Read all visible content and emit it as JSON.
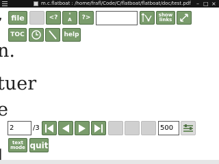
{
  "window": {
    "title": "m.c.flatboat : /home/frafl/Code/C/flatboat/flatboat/doc/test.pdf",
    "minimize_glyph": "–",
    "maximize_glyph": "□",
    "close_glyph": "×"
  },
  "document_text": [
    ",",
    "n.",
    "tuer",
    "e",
    "l"
  ],
  "toolbar": {
    "file_label": "file",
    "back_label": "<?",
    "forward_label": "?>",
    "search_value": "",
    "show_links_line1": "show",
    "show_links_line2": "links",
    "toc_label": "TOC",
    "help_label": "help",
    "font_size_glyph_small": "°",
    "font_size_glyph_large": "A"
  },
  "navigation": {
    "page_value": "2",
    "page_total": "/3",
    "zoom_value": "500",
    "text_mode_line1": "text",
    "text_mode_line2": "mode",
    "quit_label": "quit"
  },
  "icons": {
    "fit": "select-region-icon",
    "fullscreen": "fullscreen-icon",
    "timer": "clock-icon",
    "draw": "pen-icon",
    "first": "first-page-icon",
    "prev": "previous-page-icon",
    "next": "next-page-icon",
    "last": "last-page-icon",
    "settings": "settings-icon"
  },
  "colors": {
    "button": "#7a9c6c",
    "button_border": "#4f6e46",
    "disabled_button": "#d0d0d0",
    "titlebar": "#161616"
  }
}
